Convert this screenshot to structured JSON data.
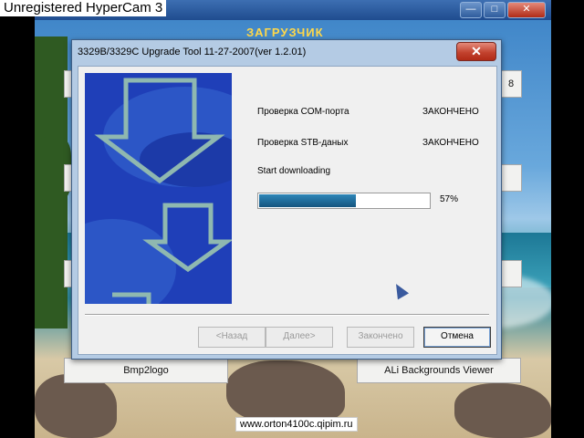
{
  "watermark": "Unregistered HyperCam 3",
  "background_window": {
    "title": "ЗАГРУЗЧИК",
    "controls": [
      "—",
      "□",
      "✕"
    ],
    "side_right_visible": "8",
    "bottom_left_button": "Bmp2logo",
    "bottom_right_button": "ALi Backgrounds Viewer"
  },
  "dialog": {
    "title": "3329B/3329C Upgrade Tool 11-27-2007(ver 1.2.01)",
    "close_glyph": "✕",
    "status_rows": [
      {
        "label": "Проверка COM-порта",
        "value": "ЗАКОНЧЕНО"
      },
      {
        "label": "Проверка  STB-даных",
        "value": "ЗАКОНЧЕНО"
      }
    ],
    "progress_label": "Start downloading",
    "progress_fraction": 0.57,
    "progress_text": "57%",
    "buttons": {
      "back": "<Назад",
      "next": "Далее>",
      "finish": "Закончено",
      "cancel": "Отмена"
    }
  },
  "footer_url": "www.orton4100c.qipim.ru",
  "colors": {
    "progress": "#15557f",
    "blue_panel": "#1f3fb8",
    "close_button": "#c3432f"
  }
}
